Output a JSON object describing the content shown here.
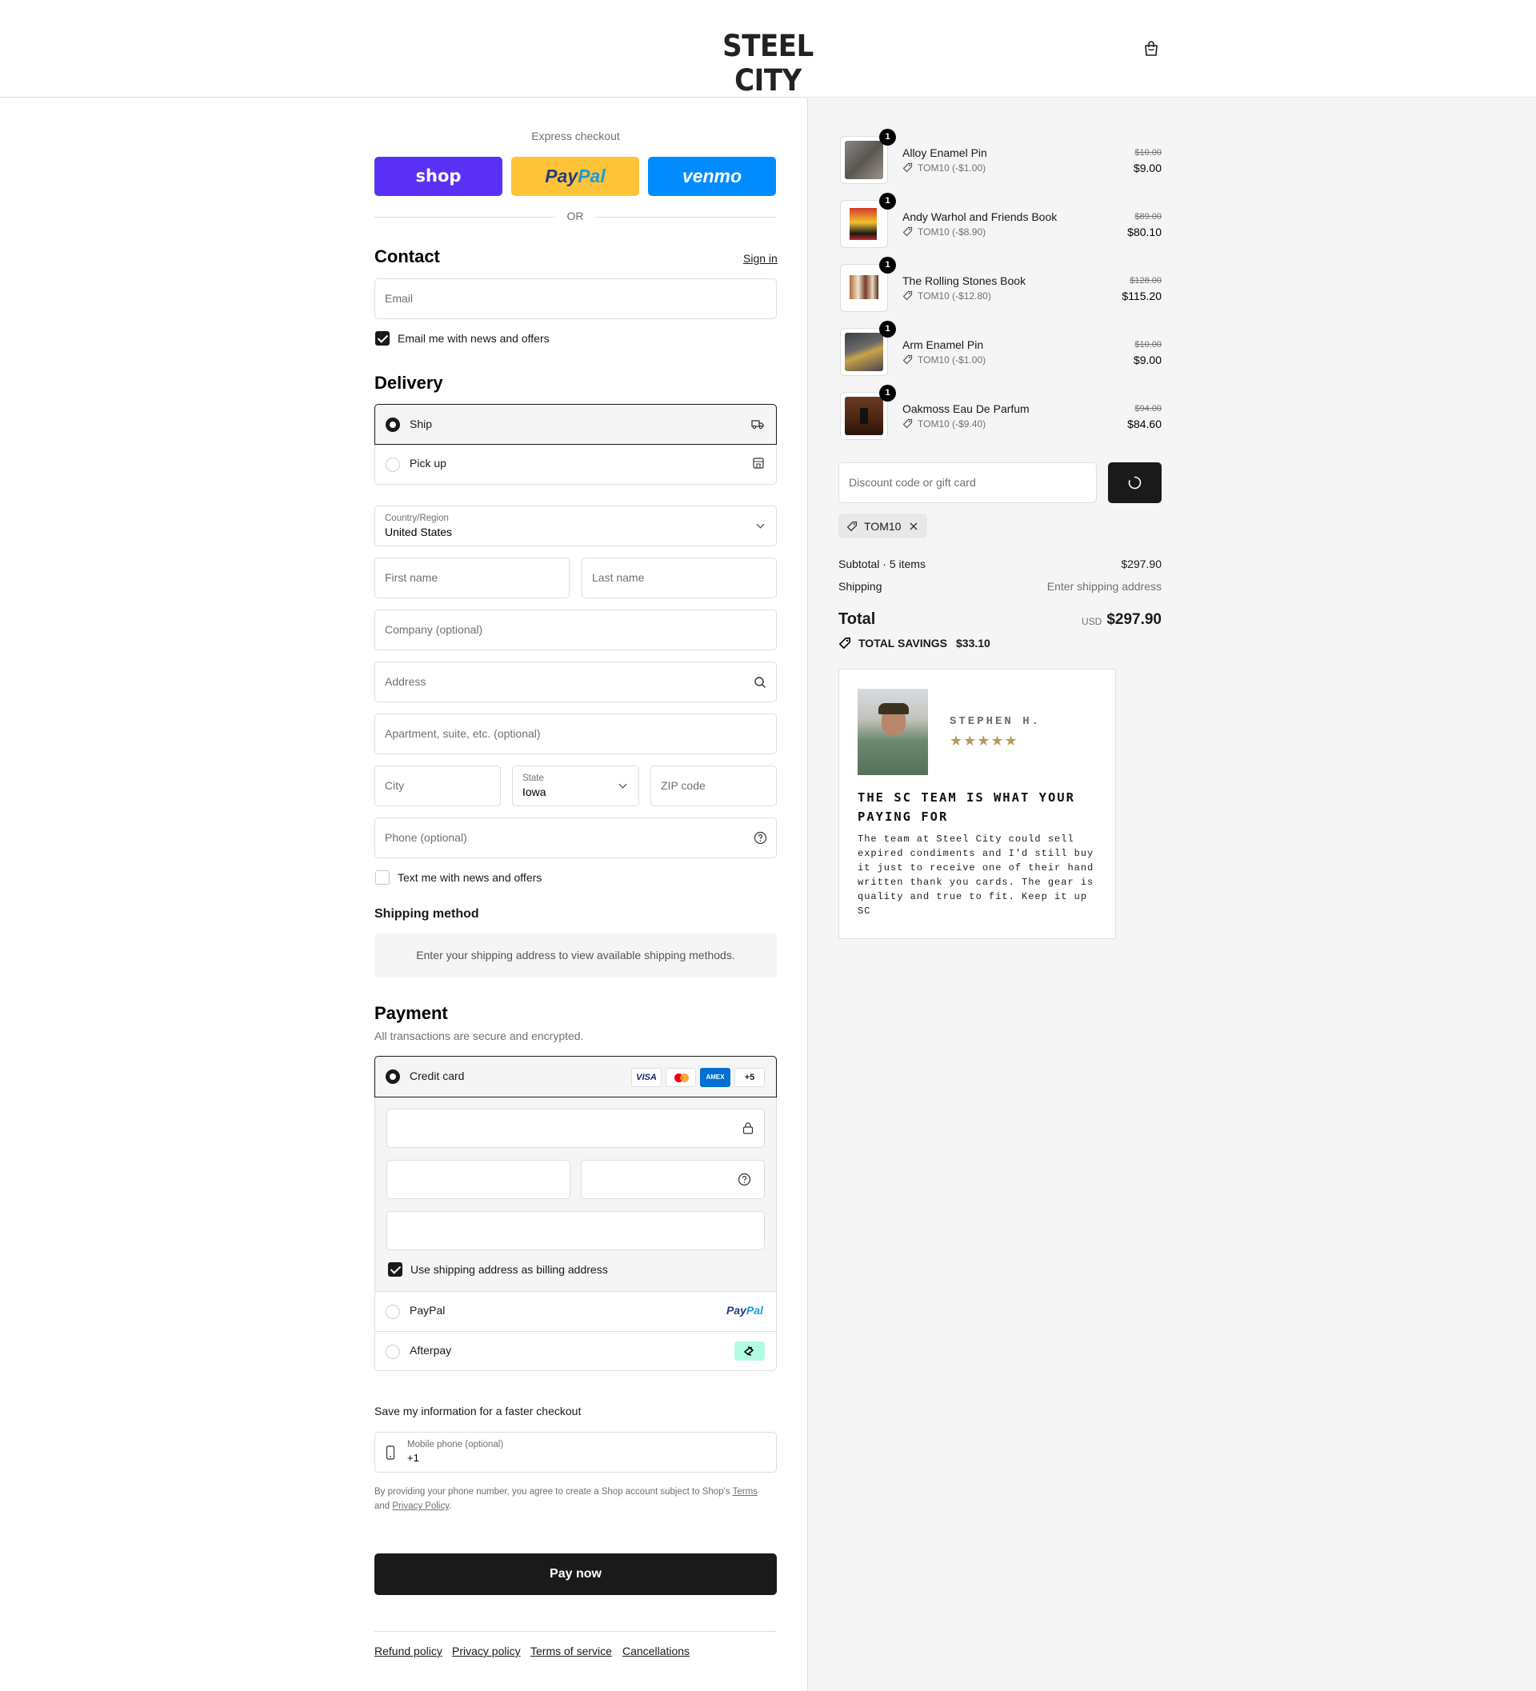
{
  "header": {
    "logo": "STEEL CITY"
  },
  "express": {
    "title": "Express checkout",
    "shop_label": "shop",
    "paypal_label_a": "Pay",
    "paypal_label_b": "Pal",
    "venmo_label": "venmo",
    "or": "OR",
    "colors": {
      "shop": "#5a31f4",
      "paypal": "#ffc439",
      "venmo": "#008cff"
    }
  },
  "contact": {
    "title": "Contact",
    "signin": "Sign in",
    "email_placeholder": "Email",
    "news_label": "Email me with news and offers"
  },
  "delivery": {
    "title": "Delivery",
    "ship_label": "Ship",
    "pickup_label": "Pick up",
    "country_label": "Country/Region",
    "country_value": "United States",
    "first_name": "First name",
    "last_name": "Last name",
    "company": "Company (optional)",
    "address": "Address",
    "apartment": "Apartment, suite, etc. (optional)",
    "city": "City",
    "state_label": "State",
    "state_value": "Iowa",
    "zip": "ZIP code",
    "phone": "Phone (optional)",
    "text_label": "Text me with news and offers"
  },
  "shipping_method": {
    "title": "Shipping method",
    "message": "Enter your shipping address to view available shipping methods."
  },
  "payment": {
    "title": "Payment",
    "subtitle": "All transactions are secure and encrypted.",
    "credit_label": "Credit card",
    "card_brands": [
      "VISA",
      "MC",
      "AMEX",
      "+5"
    ],
    "billing_label": "Use shipping address as billing address",
    "paypal_label": "PayPal",
    "paypal_logo_a": "Pay",
    "paypal_logo_b": "Pal",
    "afterpay_label": "Afterpay"
  },
  "save_info": {
    "title": "Save my information for a faster checkout",
    "phone_label": "Mobile phone (optional)",
    "phone_value": "+1",
    "legal_a": "By providing your phone number, you agree to create a Shop account subject to Shop's",
    "terms": "Terms",
    "and": "and",
    "privacy": "Privacy Policy",
    "period": "."
  },
  "pay_now": "Pay now",
  "footer": {
    "links": [
      "Refund policy",
      "Privacy policy",
      "Terms of service",
      "Cancellations"
    ]
  },
  "cart": {
    "items": [
      {
        "name": "Alloy Enamel Pin",
        "qty": "1",
        "discount": "TOM10 (-$1.00)",
        "old_price": "$10.00",
        "price": "$9.00"
      },
      {
        "name": "Andy Warhol and Friends Book",
        "qty": "1",
        "discount": "TOM10 (-$8.90)",
        "old_price": "$89.00",
        "price": "$80.10"
      },
      {
        "name": "The Rolling Stones Book",
        "qty": "1",
        "discount": "TOM10 (-$12.80)",
        "old_price": "$128.00",
        "price": "$115.20"
      },
      {
        "name": "Arm Enamel Pin",
        "qty": "1",
        "discount": "TOM10 (-$1.00)",
        "old_price": "$10.00",
        "price": "$9.00"
      },
      {
        "name": "Oakmoss Eau De Parfum",
        "qty": "1",
        "discount": "TOM10 (-$9.40)",
        "old_price": "$94.00",
        "price": "$84.60"
      }
    ],
    "discount_placeholder": "Discount code or gift card",
    "applied_code": "TOM10",
    "subtotal_label": "Subtotal · 5 items",
    "subtotal_value": "$297.90",
    "shipping_label": "Shipping",
    "shipping_value": "Enter shipping address",
    "total_label": "Total",
    "currency": "USD",
    "total_value": "$297.90",
    "savings_label": "TOTAL SAVINGS",
    "savings_value": "$33.10"
  },
  "review": {
    "name": "STEPHEN H.",
    "stars": "★★★★★",
    "rating": 5,
    "title": "THE SC TEAM IS WHAT YOUR PAYING FOR",
    "body": "The team at Steel City could sell expired condiments and I'd still buy it just to receive one of their hand written thank you cards. The gear is quality and true to fit. Keep it up SC"
  }
}
